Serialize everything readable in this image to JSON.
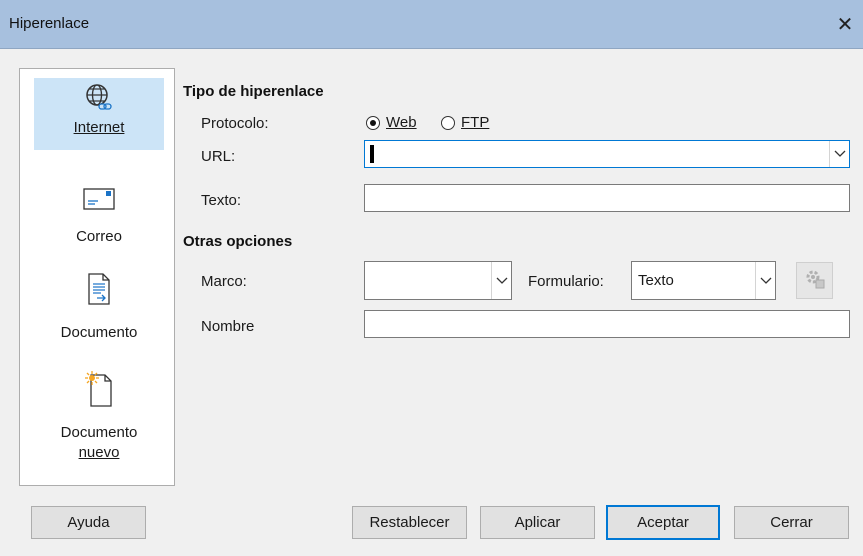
{
  "dialog": {
    "title": "Hiperenlace",
    "close_glyph": "✕"
  },
  "sidebar": {
    "items": [
      {
        "label": "Internet",
        "icon": "globe-link-icon",
        "active": true
      },
      {
        "label": "Correo",
        "icon": "envelope-icon",
        "active": false
      },
      {
        "label": "Documento",
        "icon": "document-icon",
        "active": false
      },
      {
        "label_line1": "Documento",
        "label_line2": "nuevo",
        "icon": "new-document-icon",
        "active": false
      }
    ]
  },
  "hyperlink_type": {
    "title": "Tipo de hiperenlace",
    "protocol_label": "Protocolo:",
    "protocol_options": [
      {
        "label": "Web",
        "selected": true
      },
      {
        "label": "FTP",
        "selected": false
      }
    ],
    "url_label": "URL:",
    "url_value": "",
    "text_label": "Texto:",
    "text_value": ""
  },
  "other_options": {
    "title": "Otras opciones",
    "frame_label": "Marco:",
    "frame_value": "",
    "form_label": "Formulario:",
    "form_value": "Texto",
    "events_icon": "events-icon",
    "name_label": "Nombre",
    "name_value": ""
  },
  "buttons": {
    "help": "Ayuda",
    "reset": "Restablecer",
    "apply": "Aplicar",
    "ok": "Aceptar",
    "close": "Cerrar"
  },
  "colors": {
    "titlebar": "#a7c0de",
    "active_nav": "#cce4f7",
    "focus_border": "#0078d4"
  }
}
